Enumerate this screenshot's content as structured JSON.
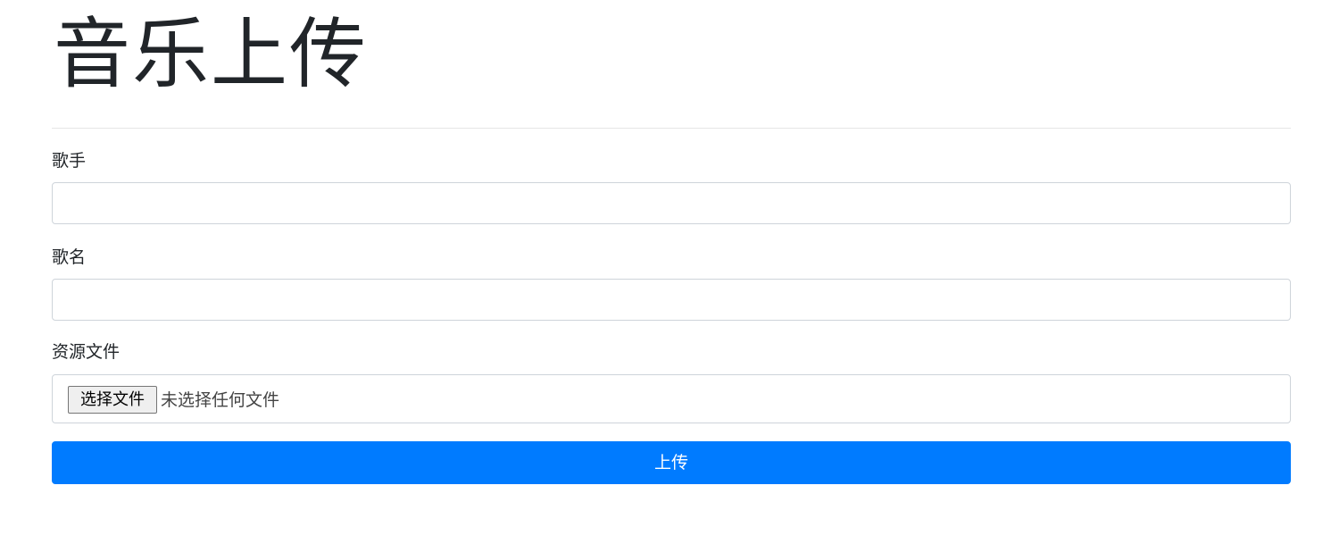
{
  "page": {
    "title": "音乐上传"
  },
  "form": {
    "singer": {
      "label": "歌手",
      "value": "",
      "placeholder": ""
    },
    "song_name": {
      "label": "歌名",
      "value": "",
      "placeholder": ""
    },
    "resource_file": {
      "label": "资源文件",
      "choose_button_label": "选择文件",
      "status_text": "未选择任何文件"
    },
    "submit_label": "上传"
  },
  "colors": {
    "primary_button": "#007bff",
    "text": "#212529",
    "input_border": "#ced4da"
  }
}
